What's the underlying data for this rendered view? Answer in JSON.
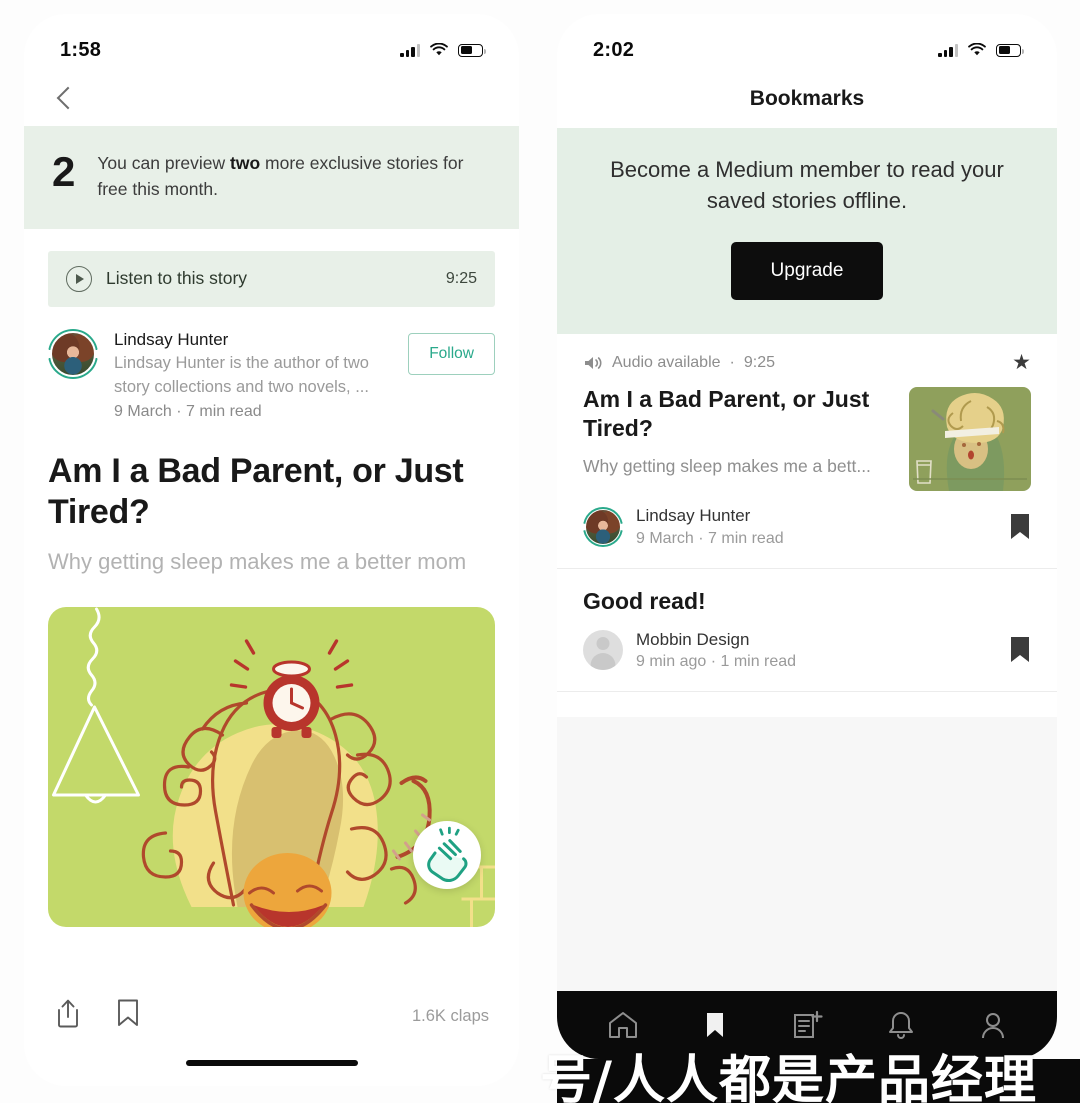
{
  "left_phone": {
    "status": {
      "time": "1:58",
      "signal_icon": "cellular-signal-icon",
      "wifi_icon": "wifi-icon",
      "battery_icon": "battery-icon"
    },
    "back_icon": "chevron-left-icon",
    "meter_banner": {
      "count": "2",
      "text_before": "You can preview ",
      "text_bold": "two",
      "text_after": " more exclusive stories for free this month."
    },
    "listen_bar": {
      "play_icon": "play-circle-icon",
      "label": "Listen to this story",
      "duration": "9:25"
    },
    "author": {
      "name": "Lindsay Hunter",
      "bio": "Lindsay Hunter is the author of two story collections and two novels, ...",
      "date_read": "9 March · 7 min read",
      "follow_label": "Follow",
      "avatar_icon": "author-avatar"
    },
    "article": {
      "title": "Am I a Bad Parent, or Just Tired?",
      "subtitle": "Why getting sleep makes me a better mom",
      "hero_alt": "illustration-woman-curly-hair-alarm-clock"
    },
    "actions": {
      "share_icon": "share-icon",
      "bookmark_icon": "bookmark-icon",
      "claps": "1.6K claps"
    }
  },
  "right_phone": {
    "status": {
      "time": "2:02",
      "signal_icon": "cellular-signal-icon",
      "wifi_icon": "wifi-icon",
      "battery_icon": "battery-icon"
    },
    "page_title": "Bookmarks",
    "upgrade_banner": {
      "text": "Become a Medium member to read your saved stories offline.",
      "button_label": "Upgrade"
    },
    "bookmarks": [
      {
        "audio_icon": "speaker-icon",
        "audio_label": "Audio available",
        "audio_separator": "·",
        "duration": "9:25",
        "star_icon": "star-icon",
        "title": "Am I a Bad Parent, or Just Tired?",
        "subtitle": "Why getting sleep makes me a bett...",
        "author": "Lindsay Hunter",
        "meta": "9 March · 7 min read",
        "thumb_alt": "illustration-thumbnail-woman-curly-hair",
        "avatar_type": "photo",
        "bookmark_icon": "bookmark-filled-icon"
      },
      {
        "title": "Good read!",
        "author": "Mobbin Design",
        "meta": "9 min ago · 1 min read",
        "avatar_type": "generic",
        "bookmark_icon": "bookmark-filled-icon"
      }
    ],
    "tabbar": [
      {
        "name": "home-icon",
        "label": "Home"
      },
      {
        "name": "bookmark-icon",
        "label": "Bookmarks"
      },
      {
        "name": "new-story-icon",
        "label": "New story"
      },
      {
        "name": "bell-icon",
        "label": "Notifications"
      },
      {
        "name": "profile-icon",
        "label": "Profile"
      }
    ]
  },
  "watermark": {
    "text": "号/人人都是产品经理"
  },
  "colors": {
    "medium_green_banner": "#e8f0e8",
    "upgrade_banner_green": "#e4efe6",
    "accent_teal": "#2aa98b",
    "ink": "#191919",
    "muted": "#9a9a9a",
    "tabbar_black": "#0a0a0a",
    "hero_green": "#c3d96a"
  }
}
